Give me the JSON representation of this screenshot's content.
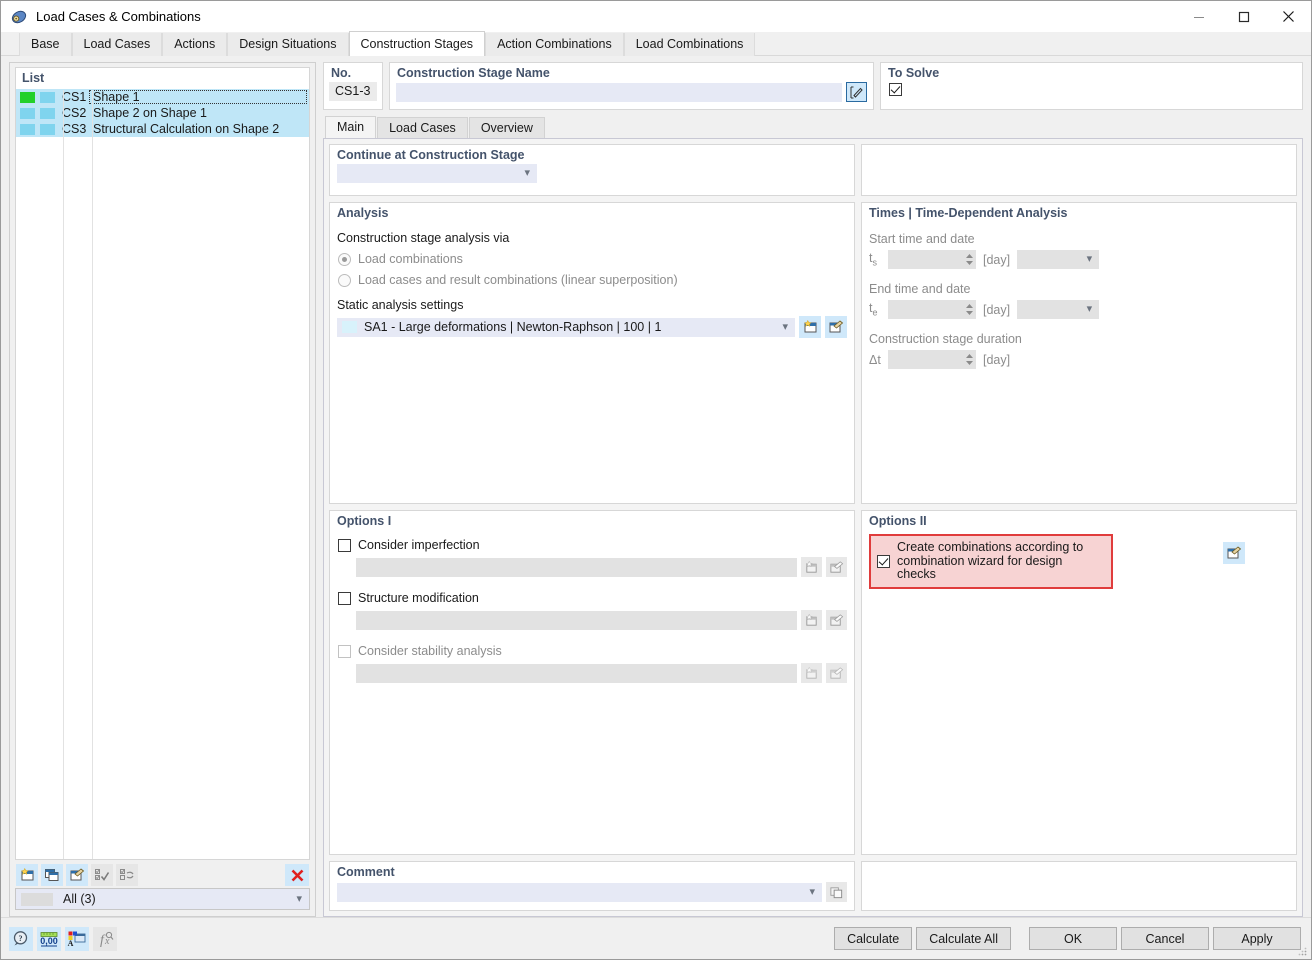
{
  "window": {
    "title": "Load Cases & Combinations",
    "icon": "app-icon",
    "minimize_label": "—",
    "maximize_label": "□",
    "close_label": "✕"
  },
  "main_tabs": [
    {
      "label": "Base",
      "active": false
    },
    {
      "label": "Load Cases",
      "active": false
    },
    {
      "label": "Actions",
      "active": false
    },
    {
      "label": "Design Situations",
      "active": false
    },
    {
      "label": "Construction Stages",
      "active": true
    },
    {
      "label": "Action Combinations",
      "active": false
    },
    {
      "label": "Load Combinations",
      "active": false
    }
  ],
  "list_panel": {
    "header": "List",
    "rows": [
      {
        "id": "CS1",
        "name": "Shape 1",
        "color": "#22d02a",
        "focused": true
      },
      {
        "id": "CS2",
        "name": "Shape 2 on Shape 1",
        "color": "#7fd4ee",
        "focused": false
      },
      {
        "id": "CS3",
        "name": "Structural Calculation on Shape 2",
        "color": "#7fd4ee",
        "focused": false
      }
    ],
    "toolbar": [
      {
        "name": "new-item-icon",
        "enabled": true
      },
      {
        "name": "copy-item-icon",
        "enabled": true
      },
      {
        "name": "edit-item-icon",
        "enabled": true
      },
      {
        "name": "select-all-icon",
        "enabled": false
      },
      {
        "name": "invert-selection-icon",
        "enabled": false
      }
    ],
    "delete_icon": "delete-icon",
    "filter_value": "All (3)"
  },
  "no_panel": {
    "label": "No.",
    "value": "CS1-3"
  },
  "name_panel": {
    "label": "Construction Stage Name",
    "value": "",
    "placeholder": "",
    "edit_icon": "rename-icon"
  },
  "to_solve_panel": {
    "label": "To Solve",
    "checked": true
  },
  "inner_tabs": [
    {
      "label": "Main",
      "active": true
    },
    {
      "label": "Load Cases",
      "active": false
    },
    {
      "label": "Overview",
      "active": false
    }
  ],
  "continue_panel": {
    "label": "Continue at Construction Stage",
    "value": ""
  },
  "analysis_panel": {
    "title": "Analysis",
    "via_label": "Construction stage analysis via",
    "options": [
      {
        "label": "Load combinations",
        "selected": true,
        "disabled": true
      },
      {
        "label": "Load cases and result combinations (linear superposition)",
        "selected": false,
        "disabled": true
      }
    ],
    "static_label": "Static analysis settings",
    "static_value": "SA1 - Large deformations | Newton-Raphson | 100 | 1",
    "new_icon": "new-settings-icon",
    "edit_icon": "edit-settings-icon"
  },
  "times_panel": {
    "title": "Times | Time-Dependent Analysis",
    "start_label": "Start time and date",
    "start_symbol": "t",
    "start_sub": "s",
    "start_value": "",
    "start_unit": "[day]",
    "start_date": "",
    "end_label": "End time and date",
    "end_symbol": "t",
    "end_sub": "e",
    "end_value": "",
    "end_unit": "[day]",
    "end_date": "",
    "duration_label": "Construction stage duration",
    "duration_symbol": "Δt",
    "duration_value": "",
    "duration_unit": "[day]"
  },
  "options1_panel": {
    "title": "Options I",
    "items": [
      {
        "label": "Consider imperfection",
        "checked": false,
        "disabled": false,
        "value": ""
      },
      {
        "label": "Structure modification",
        "checked": false,
        "disabled": false,
        "value": ""
      },
      {
        "label": "Consider stability analysis",
        "checked": false,
        "disabled": true,
        "value": ""
      }
    ],
    "new_icon": "new-icon",
    "edit_icon": "edit-icon"
  },
  "options2_panel": {
    "title": "Options II",
    "highlight_color": "#e03c3c",
    "highlight_fill": "#f7d3d3",
    "checkbox_checked": true,
    "label_line1": "Create combinations according to",
    "label_line2": "combination wizard for design checks",
    "wizard_icon": "combination-wizard-icon"
  },
  "comment_panel": {
    "label": "Comment",
    "value": "",
    "copy_icon": "copy-comment-icon"
  },
  "footer": {
    "icons": [
      {
        "name": "help-icon",
        "enabled": true
      },
      {
        "name": "units-icon",
        "enabled": true
      },
      {
        "name": "display-properties-icon",
        "enabled": true
      },
      {
        "name": "formula-icon",
        "enabled": false
      }
    ],
    "buttons": [
      {
        "label": "Calculate",
        "name": "calculate-button"
      },
      {
        "label": "Calculate All",
        "name": "calculate-all-button"
      },
      {
        "label": "OK",
        "name": "ok-button"
      },
      {
        "label": "Cancel",
        "name": "cancel-button"
      },
      {
        "label": "Apply",
        "name": "apply-button"
      }
    ]
  }
}
